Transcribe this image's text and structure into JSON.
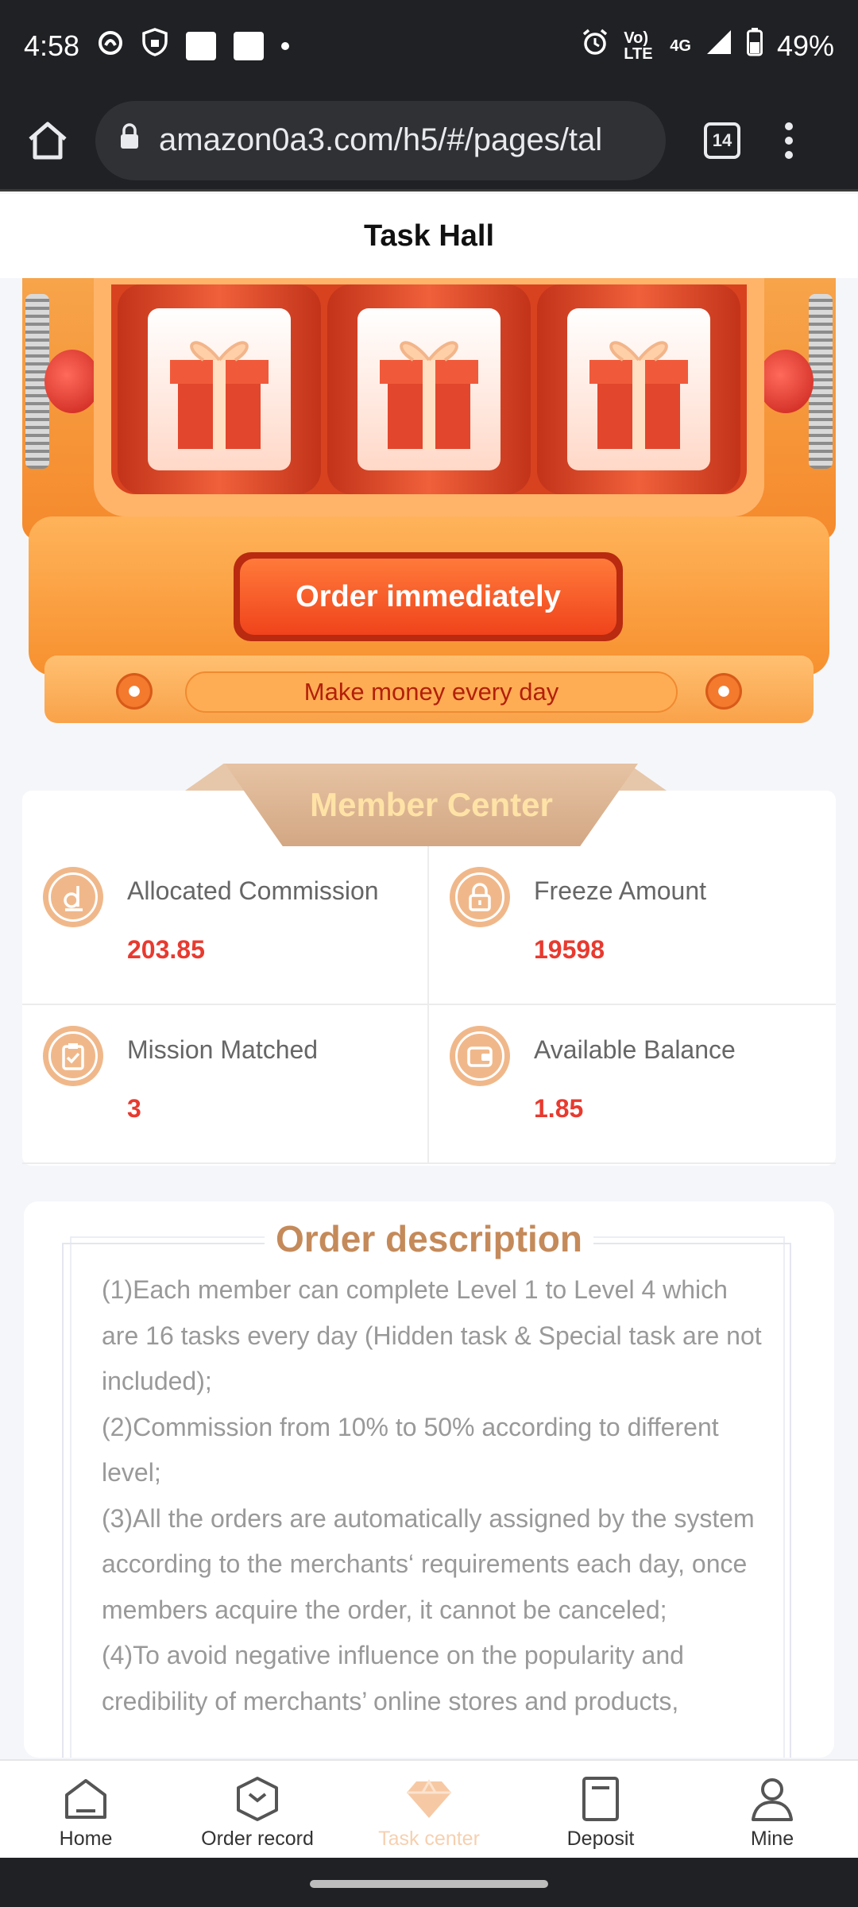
{
  "status_bar": {
    "time": "4:58",
    "network": "4G",
    "volte": "Vo) LTE",
    "battery": "49%"
  },
  "browser": {
    "url": "amazon0a3.com/h5/#/pages/tal",
    "tab_count": "14"
  },
  "header": {
    "title": "Task Hall"
  },
  "machine": {
    "order_button": "Order immediately",
    "slogan": "Make money every day",
    "reel_icon": "gift-box-icon"
  },
  "member_center": {
    "title": "Member Center",
    "stats": [
      {
        "label": "Allocated Commission",
        "value": "203.85",
        "icon": "commission-icon"
      },
      {
        "label": "Freeze Amount",
        "value": "19598",
        "icon": "lock-icon"
      },
      {
        "label": "Mission Matched",
        "value": "3",
        "icon": "clipboard-check-icon"
      },
      {
        "label": "Available Balance",
        "value": "1.85",
        "icon": "wallet-icon"
      }
    ]
  },
  "order_description": {
    "title": "Order description",
    "paragraphs": [
      "(1)Each member can complete Level 1 to Level 4 which are 16 tasks every day (Hidden task & Special task are not included);",
      "(2)Commission from 10% to 50% according to different level;",
      "(3)All the orders are automatically assigned by the system according to the merchants‘ requirements each day, once members acquire the order, it cannot be canceled;",
      "(4)To avoid negative influence on the popularity and credibility of merchants’ online stores and products,"
    ]
  },
  "bottom_nav": [
    {
      "label": "Home",
      "icon": "home-icon"
    },
    {
      "label": "Order record",
      "icon": "order-record-icon"
    },
    {
      "label": "Task center",
      "icon": "diamond-icon",
      "active": true
    },
    {
      "label": "Deposit",
      "icon": "deposit-icon"
    },
    {
      "label": "Mine",
      "icon": "user-icon"
    }
  ],
  "colors": {
    "accent_red": "#e83a2f",
    "brand_tan": "#c58a5a",
    "machine_orange": "#f58a2c",
    "active_tab": "#f6d0b0"
  }
}
